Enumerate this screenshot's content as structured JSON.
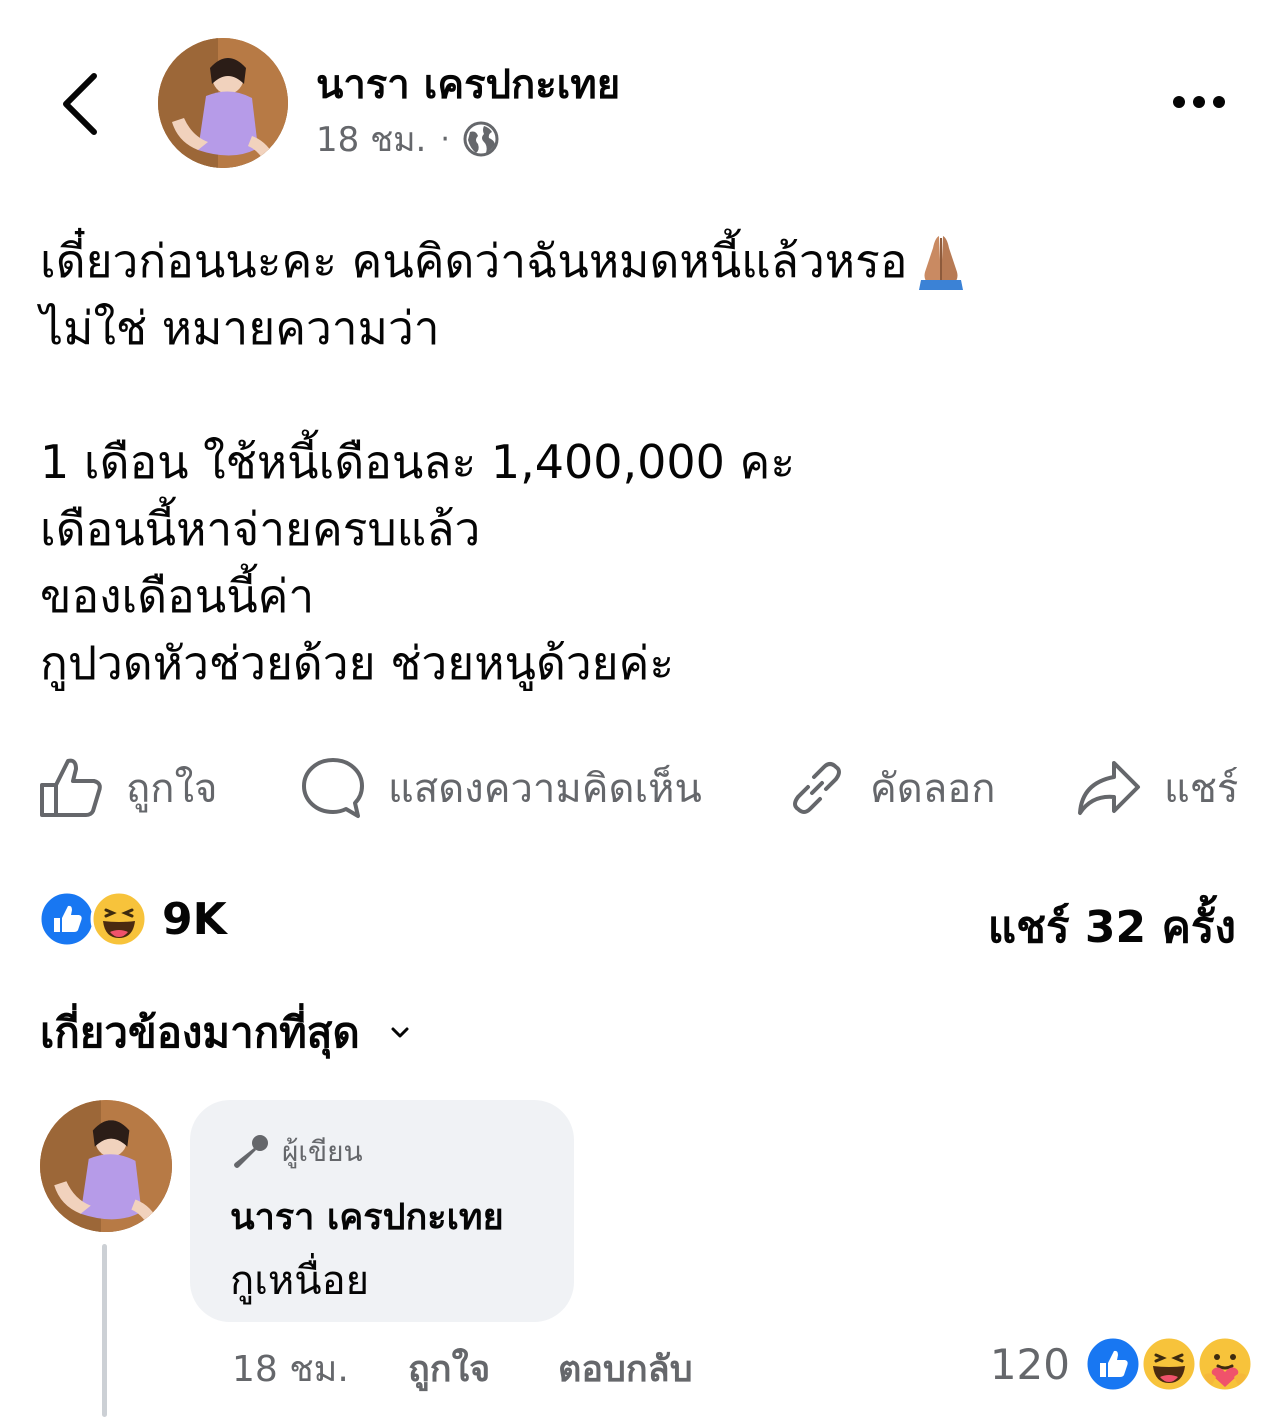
{
  "header": {
    "author_name": "นารา เครปกะเทย",
    "time": "18 ชม.",
    "separator": "·",
    "audience_icon": "globe-icon"
  },
  "post": {
    "lines": [
      "เดี๋ยวก่อนนะคะ คนคิดว่าฉันหมดหนี้แล้วหรอ",
      "ไม่ใช่  หมายความว่า",
      "",
      "1 เดือน ใช้หนี้เดือนละ 1,400,000 คะ",
      "เดือนนี้หาจ่ายครบแล้ว",
      "ของเดือนนี้ค่า",
      "กูปวดหัวช่วยด้วย  ช่วยหนูด้วยค่ะ"
    ],
    "emoji": "folded-hands-emoji"
  },
  "actions": {
    "like": "ถูกใจ",
    "comment": "แสดงความคิดเห็น",
    "copy": "คัดลอก",
    "share": "แชร์"
  },
  "stats": {
    "reaction_count": "9K",
    "reaction_icons": [
      "like-reaction-icon",
      "haha-reaction-icon"
    ],
    "share_count": "แชร์ 32 ครั้ง"
  },
  "sort": {
    "label": "เกี่ยวข้องมากที่สุด"
  },
  "comment": {
    "badge": "ผู้เขียน",
    "author": "นารา เครปกะเทย",
    "text": "กูเหนื่อย",
    "time": "18 ชม.",
    "like": "ถูกใจ",
    "reply": "ตอบกลับ",
    "reaction_count": "120",
    "reaction_icons": [
      "like-reaction-icon",
      "haha-reaction-icon",
      "care-reaction-icon"
    ]
  },
  "colors": {
    "text": "#050505",
    "secondary": "#65676b",
    "bubble": "#f0f2f5",
    "like_blue": "#1877f2",
    "haha_yellow": "#f7c33b"
  }
}
